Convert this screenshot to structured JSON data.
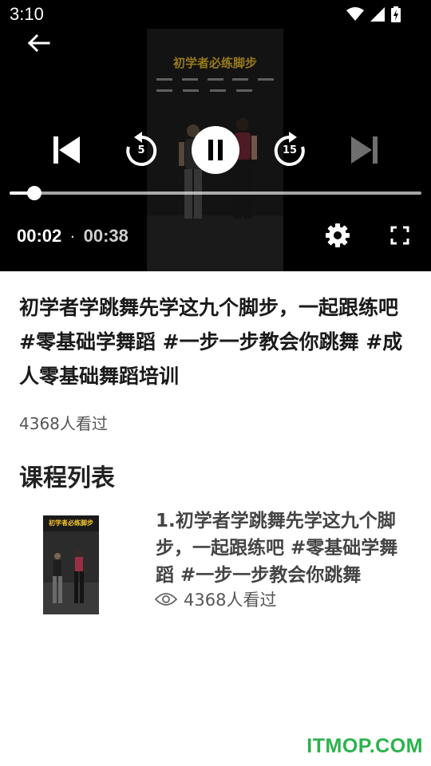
{
  "status_bar": {
    "time": "3:10"
  },
  "player": {
    "video_overlay_title": "初学者必练脚步",
    "current_time": "00:02",
    "separator": "·",
    "total_time": "00:38",
    "progress": 0.06,
    "rewind_seconds": "5",
    "forward_seconds": "15"
  },
  "video": {
    "title": "初学者学跳舞先学这九个脚步，一起跟练吧 #零基础学舞蹈 #一步一步教会你跳舞 #成人零基础舞蹈培训",
    "views": "4368人看过"
  },
  "course_list": {
    "heading": "课程列表",
    "items": [
      {
        "thumb_caption": "初学者必练脚步",
        "title": "1.初学者学跳舞先学这九个脚步，一起跟练吧 #零基础学舞蹈 #一步一步教会你跳舞",
        "views": "4368人看过"
      }
    ]
  },
  "watermark": "ITMOP.COM"
}
